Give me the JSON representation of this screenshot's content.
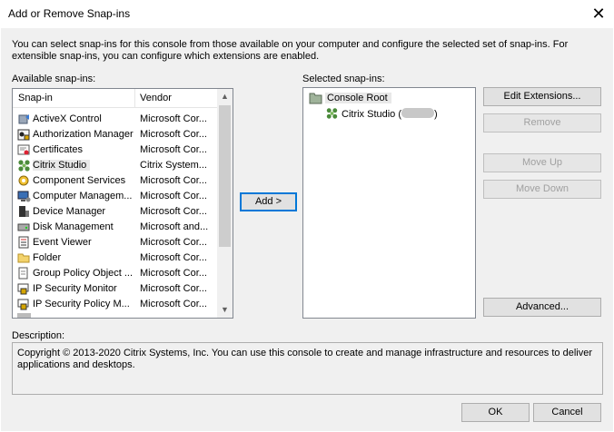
{
  "window": {
    "title": "Add or Remove Snap-ins",
    "close_glyph": "✕"
  },
  "intro": "You can select snap-ins for this console from those available on your computer and configure the selected set of snap-ins. For extensible snap-ins, you can configure which extensions are enabled.",
  "available": {
    "label": "Available snap-ins:",
    "columns": {
      "snapin": "Snap-in",
      "vendor": "Vendor"
    },
    "rows": [
      {
        "name": "ActiveX Control",
        "vendor": "Microsoft Cor...",
        "icon": "activex-icon"
      },
      {
        "name": "Authorization Manager",
        "vendor": "Microsoft Cor...",
        "icon": "authorization-icon"
      },
      {
        "name": "Certificates",
        "vendor": "Microsoft Cor...",
        "icon": "certificate-icon"
      },
      {
        "name": "Citrix Studio",
        "vendor": "Citrix System...",
        "icon": "citrix-icon"
      },
      {
        "name": "Component Services",
        "vendor": "Microsoft Cor...",
        "icon": "component-services-icon"
      },
      {
        "name": "Computer Managem...",
        "vendor": "Microsoft Cor...",
        "icon": "computer-management-icon"
      },
      {
        "name": "Device Manager",
        "vendor": "Microsoft Cor...",
        "icon": "device-manager-icon"
      },
      {
        "name": "Disk Management",
        "vendor": "Microsoft and...",
        "icon": "disk-icon"
      },
      {
        "name": "Event Viewer",
        "vendor": "Microsoft Cor...",
        "icon": "event-viewer-icon"
      },
      {
        "name": "Folder",
        "vendor": "Microsoft Cor...",
        "icon": "folder-icon"
      },
      {
        "name": "Group Policy Object ...",
        "vendor": "Microsoft Cor...",
        "icon": "group-policy-icon"
      },
      {
        "name": "IP Security Monitor",
        "vendor": "Microsoft Cor...",
        "icon": "ip-security-icon"
      },
      {
        "name": "IP Security Policy M...",
        "vendor": "Microsoft Cor...",
        "icon": "ip-security-icon"
      }
    ],
    "scroll_up": "▲",
    "scroll_down": "▼"
  },
  "add_button": "Add >",
  "selected": {
    "label": "Selected snap-ins:",
    "root": "Console Root",
    "child_prefix": "Citrix Studio (",
    "child_suffix": ")"
  },
  "buttons": {
    "edit_extensions": "Edit Extensions...",
    "remove": "Remove",
    "move_up": "Move Up",
    "move_down": "Move Down",
    "advanced": "Advanced...",
    "ok": "OK",
    "cancel": "Cancel"
  },
  "description": {
    "label": "Description:",
    "text": "Copyright © 2013-2020 Citrix Systems, Inc.  You can use this console to create and manage infrastructure and resources to deliver applications and desktops."
  }
}
